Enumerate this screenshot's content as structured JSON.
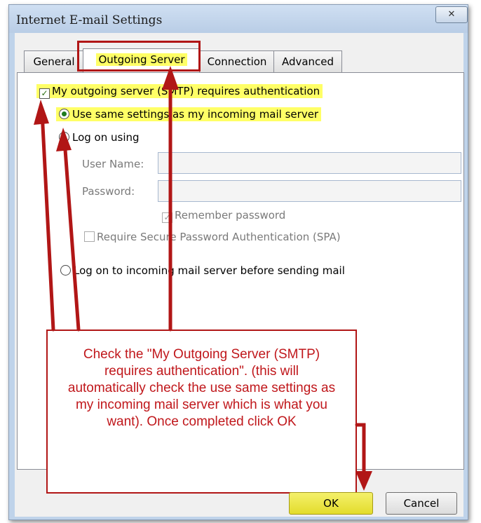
{
  "window": {
    "title": "Internet E-mail Settings",
    "close_glyph": "✕"
  },
  "tabs": [
    {
      "label": "General",
      "active": false
    },
    {
      "label": "Outgoing Server",
      "active": true
    },
    {
      "label": "Connection",
      "active": false
    },
    {
      "label": "Advanced",
      "active": false
    }
  ],
  "outgoing": {
    "requires_auth_label": "My outgoing server (SMTP) requires authentication",
    "requires_auth_checked": true,
    "use_same_label": "Use same settings as my incoming mail server",
    "log_on_using_label": "Log on using",
    "user_name_label": "User Name:",
    "password_label": "Password:",
    "remember_password_label": "Remember password",
    "spa_label": "Require Secure Password Authentication (SPA)",
    "log_on_incoming_label": "Log on to incoming mail server before sending mail"
  },
  "callout": {
    "text": "Check the \"My Outgoing Server (SMTP) requires authentication\".  (this will automatically check the use same settings as my incoming mail server which is what you want).  Once completed click OK"
  },
  "buttons": {
    "ok": "OK",
    "cancel": "Cancel"
  },
  "colors": {
    "annotation": "#b11616",
    "highlight": "#ffff66",
    "dialog_frame": "#bfd3ea"
  }
}
